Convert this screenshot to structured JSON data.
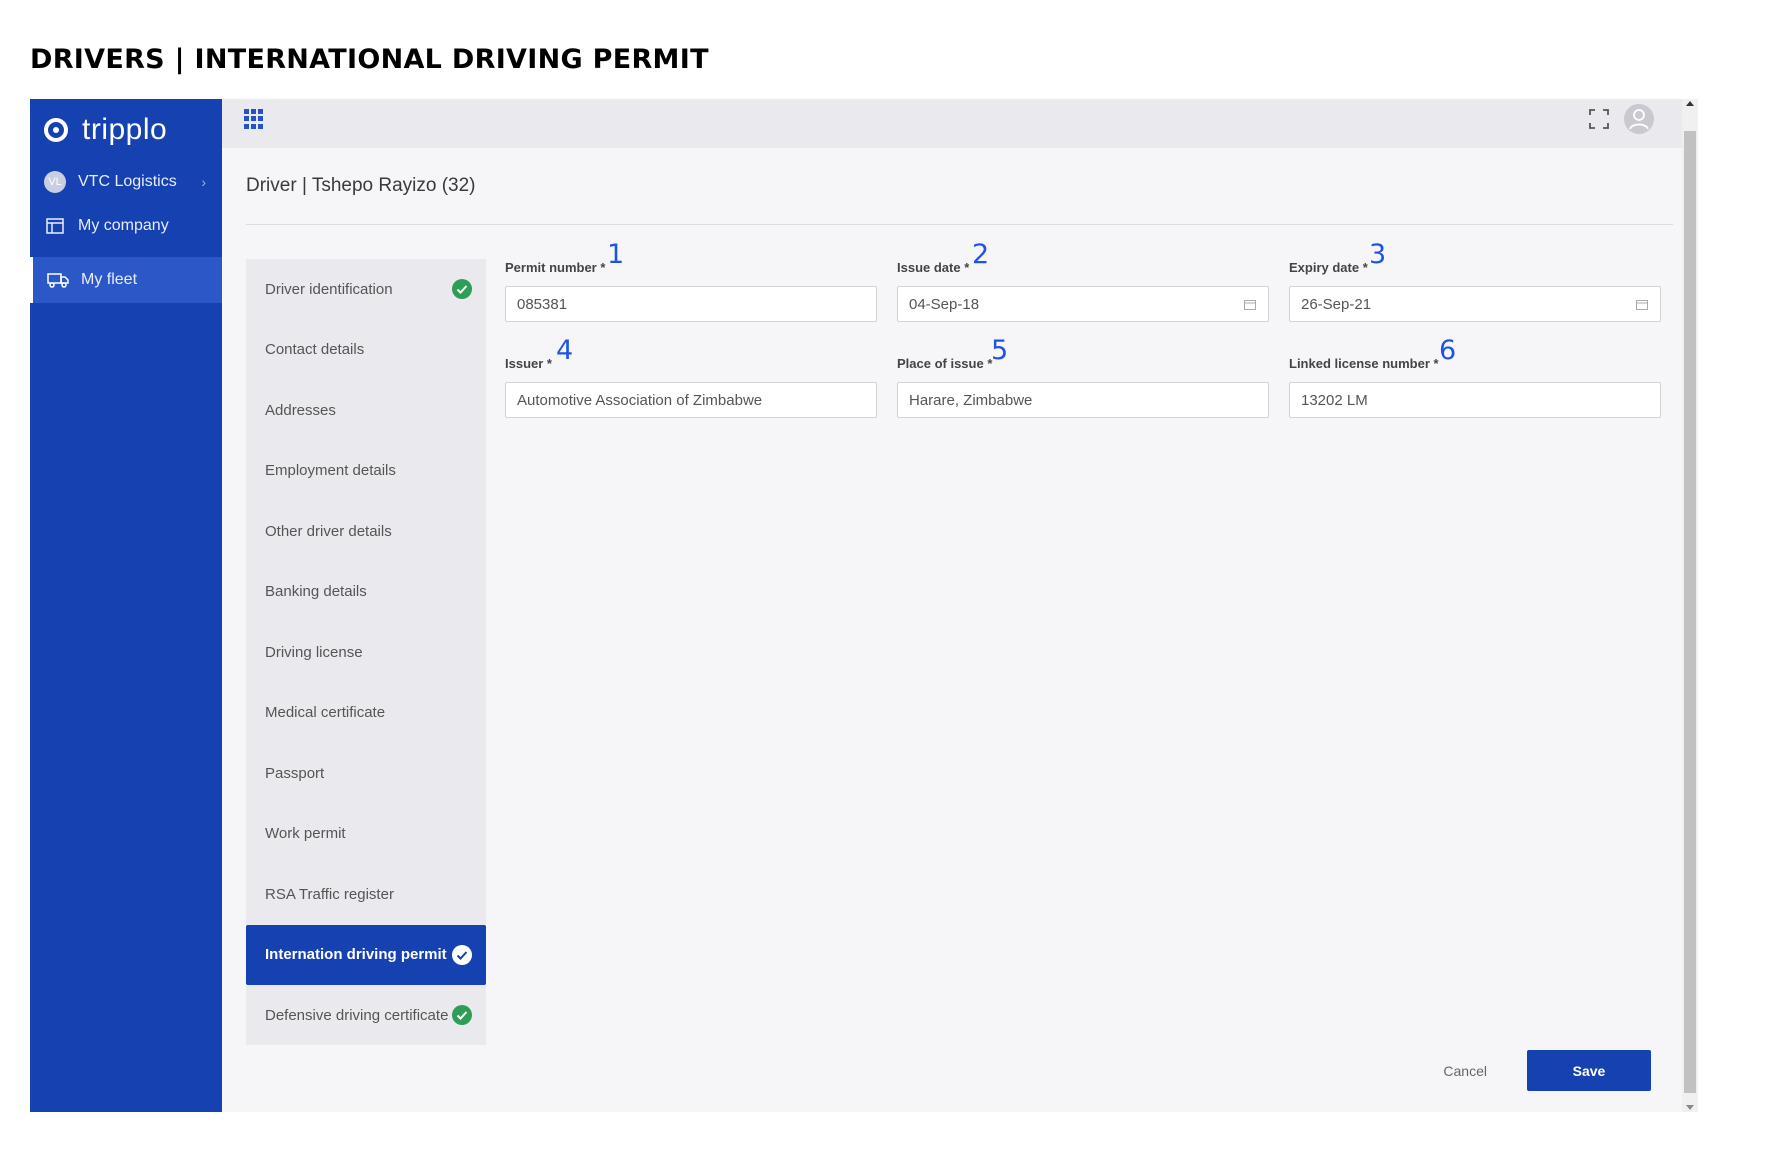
{
  "doc_title": "DRIVERS | INTERNATIONAL DRIVING PERMIT",
  "brand": {
    "name": "tripplo"
  },
  "sidebar": {
    "org": {
      "initials": "VL",
      "label": "VTC Logistics"
    },
    "items": [
      {
        "label": "My company",
        "icon": "building-icon"
      },
      {
        "label": "My fleet",
        "icon": "truck-icon",
        "active": true
      }
    ]
  },
  "header": {
    "page_title": "Driver | Tshepo Rayizo (32)"
  },
  "sections": [
    {
      "label": "Driver identification",
      "complete": true
    },
    {
      "label": "Contact details"
    },
    {
      "label": "Addresses"
    },
    {
      "label": "Employment details"
    },
    {
      "label": "Other driver details"
    },
    {
      "label": "Banking details"
    },
    {
      "label": "Driving license"
    },
    {
      "label": "Medical certificate"
    },
    {
      "label": "Passport"
    },
    {
      "label": "Work permit"
    },
    {
      "label": "RSA Traffic register"
    },
    {
      "label": "Internation driving permit",
      "complete": true,
      "active": true
    },
    {
      "label": "Defensive driving certificate",
      "complete": true
    }
  ],
  "form": {
    "permit_number": {
      "label": "Permit number *",
      "value": "085381",
      "marker": "1"
    },
    "issue_date": {
      "label": "Issue date *",
      "value": "04-Sep-18",
      "marker": "2"
    },
    "expiry_date": {
      "label": "Expiry date *",
      "value": "26-Sep-21",
      "marker": "3"
    },
    "issuer": {
      "label": "Issuer *",
      "value": "Automotive Association of Zimbabwe",
      "marker": "4"
    },
    "place_of_issue": {
      "label": "Place of issue *",
      "value": "Harare, Zimbabwe",
      "marker": "5"
    },
    "linked_license_number": {
      "label": "Linked license number *",
      "value": "13202 LM",
      "marker": "6"
    }
  },
  "actions": {
    "cancel_label": "Cancel",
    "save_label": "Save"
  },
  "colors": {
    "brand": "#1642b1",
    "check": "#2e9e57",
    "marker": "#1e54e6"
  }
}
